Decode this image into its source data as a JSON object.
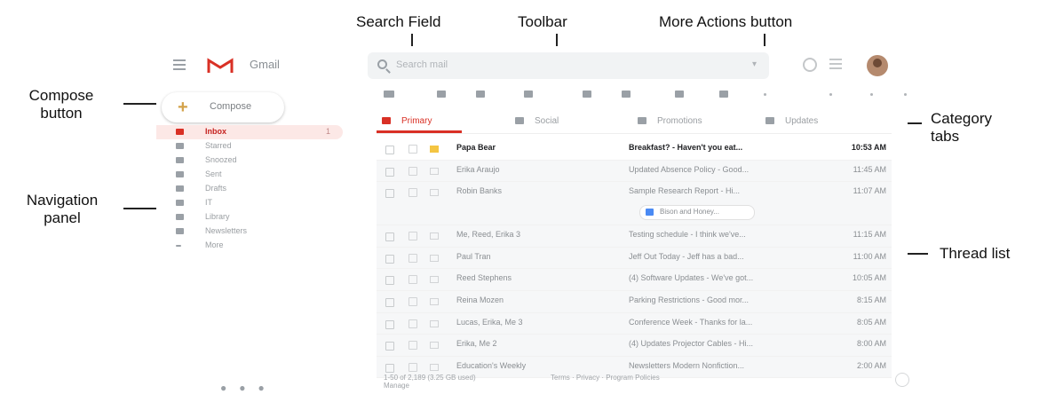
{
  "callouts": {
    "search_field": "Search Field",
    "toolbar": "Toolbar",
    "more_actions": "More Actions button",
    "compose_line1": "Compose",
    "compose_line2": "button",
    "category_line1": "Category",
    "category_line2": "tabs",
    "navigation_line1": "Navigation",
    "navigation_line2": "panel",
    "thread_list": "Thread list"
  },
  "app": {
    "name": "Gmail",
    "search_placeholder": "Search mail",
    "compose_label": "Compose"
  },
  "nav": {
    "items": [
      {
        "label": "Inbox",
        "count": "1",
        "active": true
      },
      {
        "label": "Starred",
        "count": ""
      },
      {
        "label": "Snoozed",
        "count": ""
      },
      {
        "label": "Sent",
        "count": ""
      },
      {
        "label": "Drafts",
        "count": ""
      },
      {
        "label": "IT",
        "count": ""
      },
      {
        "label": "Library",
        "count": ""
      },
      {
        "label": "Newsletters",
        "count": ""
      },
      {
        "label": "More",
        "count": ""
      }
    ]
  },
  "tabs": [
    {
      "label": "Primary",
      "active": true
    },
    {
      "label": "Social"
    },
    {
      "label": "Promotions"
    },
    {
      "label": "Updates"
    }
  ],
  "threads": [
    {
      "sender": "Papa Bear",
      "subject": "Breakfast? - Haven't you eat...",
      "time": "10:53 AM",
      "unread": true,
      "important": true
    },
    {
      "sender": "Erika Araujo",
      "subject": "Updated Absence Policy - Good...",
      "time": "11:45 AM"
    },
    {
      "sender": "Robin Banks",
      "subject": "Sample Research Report - Hi...",
      "time": "11:07 AM",
      "attachment": "Bison and Honey..."
    },
    {
      "sender": "Me, Reed, Erika 3",
      "subject": "Testing schedule - I think we've...",
      "time": "11:15 AM"
    },
    {
      "sender": "Paul Tran",
      "subject": "Jeff Out Today - Jeff has a bad...",
      "time": "11:00 AM"
    },
    {
      "sender": "Reed Stephens",
      "subject": "(4) Software Updates - We've got...",
      "time": "10:05 AM"
    },
    {
      "sender": "Reina Mozen",
      "subject": "Parking Restrictions - Good mor...",
      "time": "8:15 AM"
    },
    {
      "sender": "Lucas, Erika, Me 3",
      "subject": "Conference Week - Thanks for la...",
      "time": "8:05 AM"
    },
    {
      "sender": "Erika, Me 2",
      "subject": "(4) Updates Projector Cables - Hi...",
      "time": "8:00 AM"
    },
    {
      "sender": "Education's Weekly",
      "subject": "Newsletters Modern Nonfiction...",
      "time": "2:00 AM"
    }
  ],
  "footer": {
    "count": "1-50 of 2,189 (3.25 GB used)",
    "manage": "Manage",
    "links": "Terms · Privacy · Program Policies"
  },
  "colors": {
    "accent": "#d93025",
    "active_bg": "#fce8e6",
    "search_bg": "#f1f3f4"
  }
}
